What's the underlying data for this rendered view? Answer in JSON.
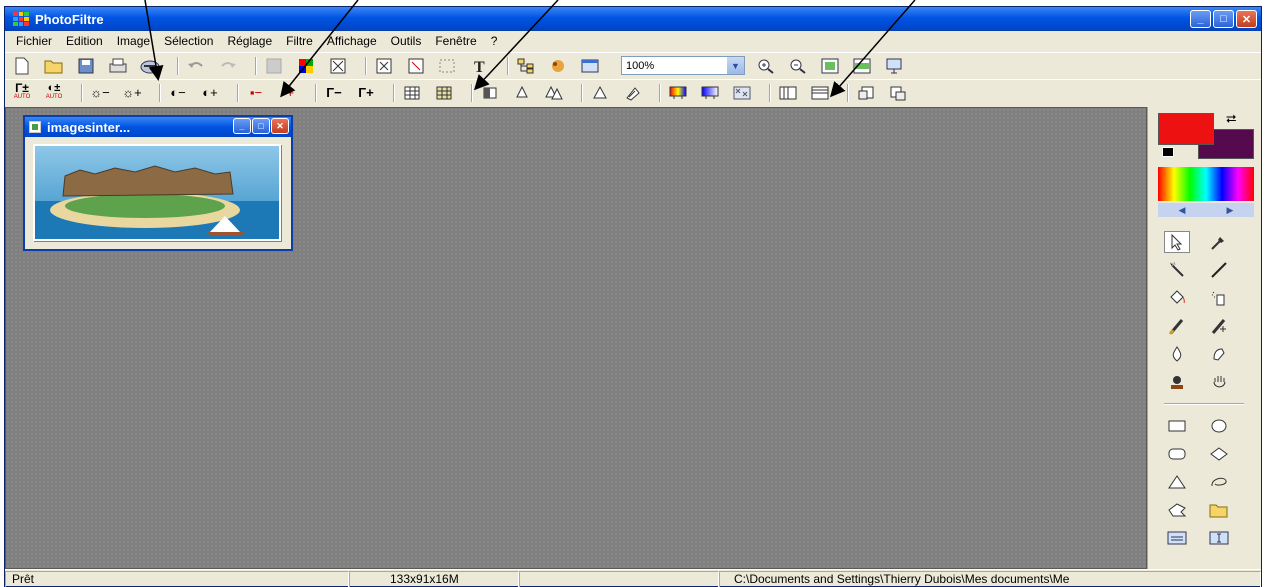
{
  "window": {
    "title": "PhotoFiltre"
  },
  "window_buttons": {
    "minimize": "_",
    "maximize": "□",
    "close": "✕"
  },
  "menu": [
    "Fichier",
    "Edition",
    "Image",
    "Sélection",
    "Réglage",
    "Filtre",
    "Affichage",
    "Outils",
    "Fenêtre",
    "?"
  ],
  "toolbar1": {
    "icons": [
      "new-icon",
      "open-icon",
      "save-icon",
      "print-icon",
      "scan-icon",
      "undo-icon",
      "redo-icon",
      "fill-icon",
      "palette-icon",
      "filter-icon",
      "zoom-in-frame-icon",
      "zoom-out-frame-icon",
      "selection-icon",
      "text-tool-icon",
      "tree-icon",
      "plugin-icon",
      "preview-icon",
      "zoom-in-icon",
      "zoom-out-icon",
      "fit-icon",
      "fit-width-icon",
      "fullscreen-icon"
    ],
    "zoom_value": "100%"
  },
  "toolbar2": {
    "auto_level": "Γ±",
    "auto_contrast": "◐±",
    "auto_label": "AUTO",
    "brightness_minus": "☼−",
    "brightness_plus": "☼+",
    "contrast_minus": "◐−",
    "contrast_plus": "◐+",
    "saturation_minus": "▪−",
    "saturation_plus": "▪+",
    "gamma_minus": "Γ−",
    "gamma_plus": "Γ+"
  },
  "child_window": {
    "title": "imagesinter..."
  },
  "colors": {
    "foreground": "#ee1111",
    "background": "#550a4e"
  },
  "statusbar": {
    "status": "Prêt",
    "dimensions": "133x91x16M",
    "path": "C:\\Documents and Settings\\Thierry Dubois\\Mes documents\\Me"
  }
}
